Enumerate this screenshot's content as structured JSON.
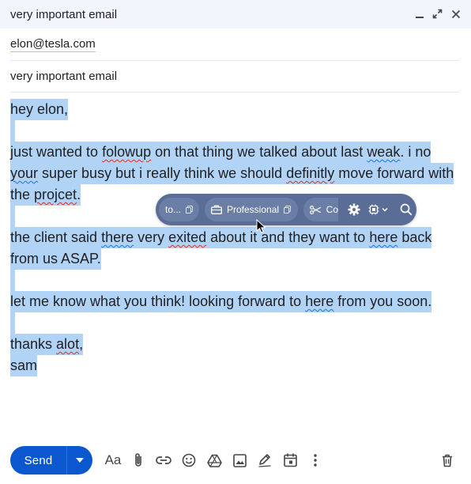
{
  "window": {
    "title": "very important email"
  },
  "compose": {
    "to": "elon@tesla.com",
    "subject": "very important email"
  },
  "body_lines": [
    "hey elon,",
    "",
    "just wanted to folowup on that thing we talked about last weak. i no",
    "your super busy but i really think we should definitly move forward with",
    "the projcet.",
    "",
    "the client said there very exited about it and they want to here back",
    "from us ASAP.",
    "",
    "let me know what you think! looking forward to here from you soon.",
    "",
    "thanks alot,",
    "sam"
  ],
  "toolbar": {
    "chip1_label": "to...",
    "chip2_label": "Professional",
    "chip3_label": "Co"
  },
  "bottom": {
    "send_label": "Send",
    "format_label": "Aa"
  },
  "colors": {
    "accent": "#0b57d0",
    "selection": "#b1d3f6",
    "toolbar_bg": "#5a6d96",
    "titlebar_bg": "#f2f6fc"
  }
}
